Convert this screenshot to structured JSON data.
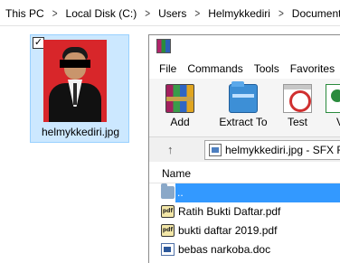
{
  "explorer": {
    "breadcrumbs": [
      "This PC",
      "Local Disk (C:)",
      "Users",
      "Helmykkediri",
      "Documents"
    ],
    "file": {
      "name": "helmykkediri.jpg",
      "checked": true
    }
  },
  "winrar": {
    "menu": [
      "File",
      "Commands",
      "Tools",
      "Favorites"
    ],
    "toolbar": [
      "Add",
      "Extract To",
      "Test",
      "V"
    ],
    "path": "helmykkediri.jpg - SFX RA",
    "list_header": "Name",
    "files": [
      {
        "name": "..",
        "icon": "folder-icon",
        "selected": true
      },
      {
        "name": "Ratih Bukti Daftar.pdf",
        "icon": "pdf-icon"
      },
      {
        "name": "bukti daftar 2019.pdf",
        "icon": "pdf-icon"
      },
      {
        "name": "bebas narkoba.doc",
        "icon": "doc-icon"
      }
    ],
    "pdf_badge": "pdf"
  },
  "colors": {
    "selection": "#3399ff",
    "tile_hover": "#cce8ff",
    "photo_background": "#d8262a"
  }
}
